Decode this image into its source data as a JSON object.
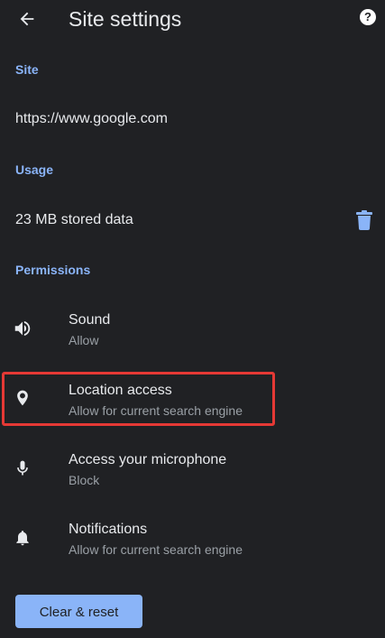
{
  "header": {
    "title": "Site settings",
    "back_icon": "arrow-left-icon",
    "help_icon": "help-circle-icon",
    "help_glyph": "?"
  },
  "site": {
    "section_label": "Site",
    "url": "https://www.google.com"
  },
  "usage": {
    "section_label": "Usage",
    "stored_data": "23 MB stored data",
    "delete_icon": "trash-icon"
  },
  "permissions": {
    "section_label": "Permissions",
    "items": [
      {
        "icon": "speaker-icon",
        "title": "Sound",
        "subtitle": "Allow"
      },
      {
        "icon": "location-pin-icon",
        "title": "Location access",
        "subtitle": "Allow for current search engine"
      },
      {
        "icon": "microphone-icon",
        "title": "Access your microphone",
        "subtitle": "Block"
      },
      {
        "icon": "bell-icon",
        "title": "Notifications",
        "subtitle": "Allow for current search engine"
      }
    ]
  },
  "footer": {
    "clear_reset_label": "Clear & reset"
  },
  "colors": {
    "background": "#202124",
    "accent": "#8ab4f8",
    "text_primary": "#e8eaed",
    "text_secondary": "#9aa0a6",
    "highlight": "#e53935"
  }
}
